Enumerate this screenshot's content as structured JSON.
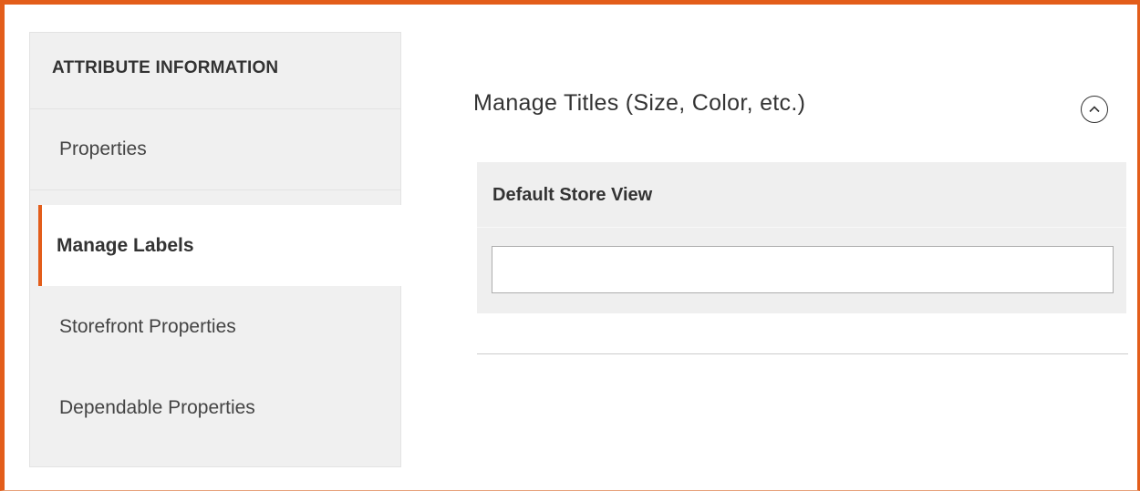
{
  "sidebar": {
    "header": "ATTRIBUTE INFORMATION",
    "items": [
      {
        "label": "Properties",
        "active": false
      },
      {
        "label": "Manage Labels",
        "active": true
      },
      {
        "label": "Storefront Properties",
        "active": false
      },
      {
        "label": "Dependable Properties",
        "active": false
      }
    ]
  },
  "main": {
    "section_title": "Manage Titles (Size, Color, etc.)",
    "collapse_icon": "chevron-up-circle-icon",
    "table": {
      "column_header": "Default Store View",
      "input_value": "",
      "input_placeholder": ""
    }
  },
  "colors": {
    "accent": "#e35d1a",
    "sidebar_bg": "#f0f0f0",
    "table_bg": "#efefef"
  }
}
